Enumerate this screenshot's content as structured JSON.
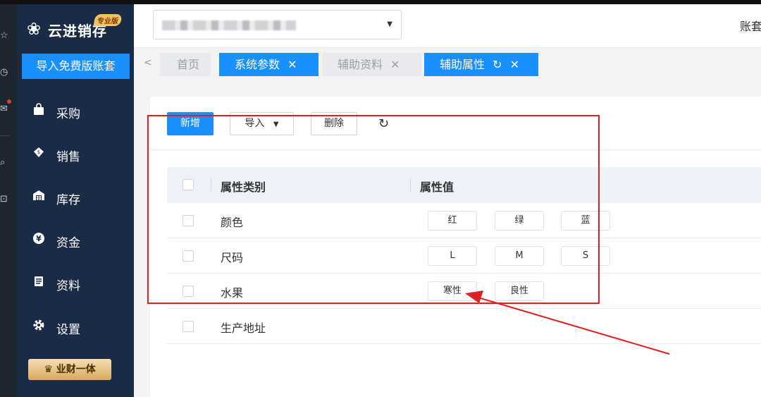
{
  "brand": {
    "logo_icon": "cloud-logo-icon",
    "name": "云进销存",
    "edition_badge": "专业版"
  },
  "sidebar": {
    "import_button": "导入免费版账套",
    "items": [
      {
        "label": "采购",
        "icon": "bag-icon"
      },
      {
        "label": "销售",
        "icon": "sales-icon"
      },
      {
        "label": "库存",
        "icon": "warehouse-icon"
      },
      {
        "label": "资金",
        "icon": "yen-icon"
      },
      {
        "label": "资料",
        "icon": "document-icon"
      },
      {
        "label": "设置",
        "icon": "gear-icon"
      }
    ],
    "promo_label": "业财一体"
  },
  "left_rail": {
    "icons": [
      "star-icon",
      "clock-icon",
      "message-icon",
      "search-icon",
      "contact-icon"
    ]
  },
  "header": {
    "account_label": "账套",
    "select_placeholder": ""
  },
  "tabs": [
    {
      "label": "首页",
      "closable": false,
      "active": false
    },
    {
      "label": "系统参数",
      "closable": true,
      "active": true
    },
    {
      "label": "辅助资料",
      "closable": true,
      "active": false
    },
    {
      "label": "辅助属性",
      "closable": true,
      "active": true,
      "refresh": true
    }
  ],
  "toolbar": {
    "new_label": "新增",
    "import_label": "导入",
    "delete_label": "删除"
  },
  "table": {
    "columns": [
      "属性类别",
      "属性值"
    ],
    "rows": [
      {
        "category": "颜色",
        "values": [
          "红",
          "绿",
          "蓝"
        ]
      },
      {
        "category": "尺码",
        "values": [
          "L",
          "M",
          "S"
        ]
      },
      {
        "category": "水果",
        "values": [
          "寒性",
          "良性"
        ]
      },
      {
        "category": "生产地址",
        "values": []
      }
    ]
  },
  "colors": {
    "primary": "#1890ff",
    "sidebar_bg": "#1a2b45",
    "annotation": "#e02020"
  }
}
